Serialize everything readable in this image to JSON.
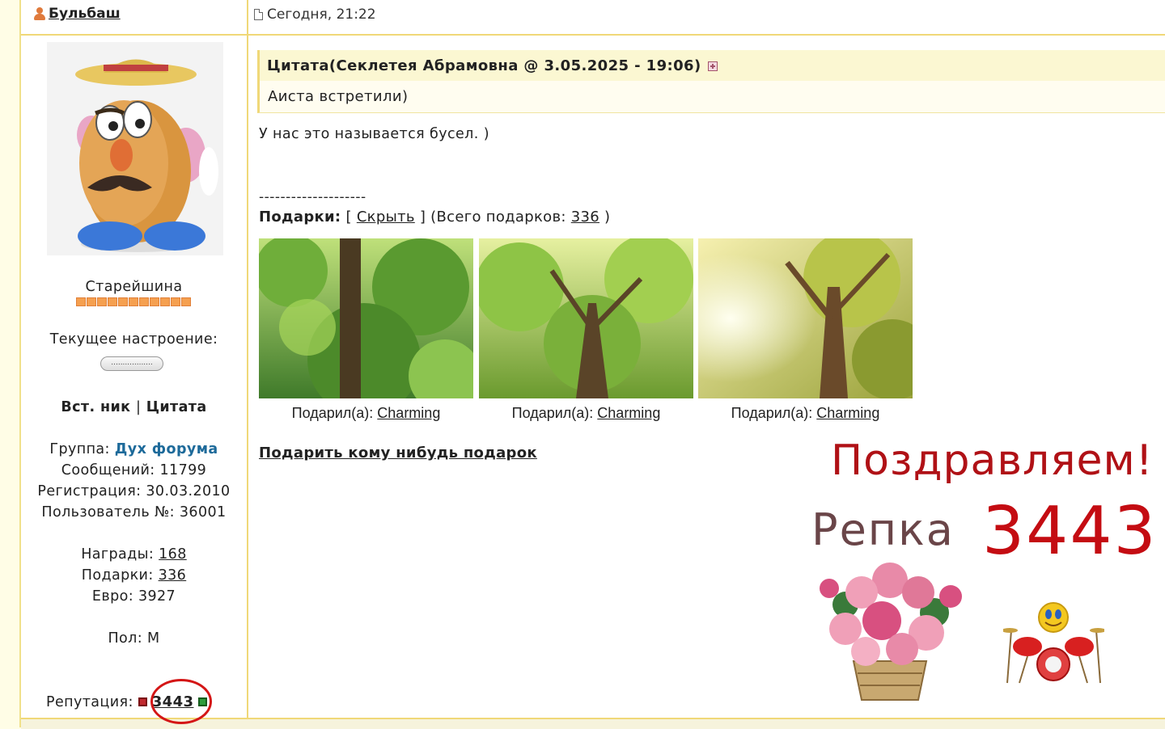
{
  "header": {
    "username": "Бульбаш",
    "post_date": "Сегодня, 21:22"
  },
  "sidebar": {
    "rank": "Старейшина",
    "mood_label": "Текущее настроение:",
    "mood_button": "..................",
    "ins_nick": "Вст. ник",
    "separator": "|",
    "quote_link": "Цитата",
    "group_label": "Группа: ",
    "group_name": "Дух форума",
    "posts": "Сообщений: 11799",
    "registration": "Регистрация: 30.03.2010",
    "user_no": "Пользователь №: 36001",
    "awards_label": "Награды: ",
    "awards_value": "168",
    "gifts_label": "Подарки: ",
    "gifts_value": "336",
    "euro": "Евро: 3927",
    "gender": "Пол: М",
    "reputation_label": "Репутация:",
    "reputation_value": "3443"
  },
  "post": {
    "quote_title": "Цитата(Секлетея Абрамовна @ 3.05.2025 - 19:06)",
    "quote_text": "Аиста встретили)",
    "text": "У нас это называется бусел. )",
    "divider": "--------------------",
    "gifts_label": "Подарки:",
    "gifts_open": " [ ",
    "hide_link": "Скрыть",
    "gifts_mid": " ] (Всего подарков: ",
    "gifts_total": "336",
    "gifts_close": " )",
    "gifts": [
      {
        "caption_label": "Подарил(а): ",
        "giver": "Charming"
      },
      {
        "caption_label": "Подарил(а): ",
        "giver": "Charming"
      },
      {
        "caption_label": "Подарил(а): ",
        "giver": "Charming"
      }
    ],
    "give_gift_link": "Подарить кому нибудь подарок"
  },
  "overlay": {
    "congrats": "Поздравляем!",
    "name": "Репка",
    "number": "3443"
  },
  "colors": {
    "border": "#f0d878",
    "quote_bg": "#fbf7d2",
    "group": "#1d6a9a",
    "accent_red": "#c40c12"
  }
}
